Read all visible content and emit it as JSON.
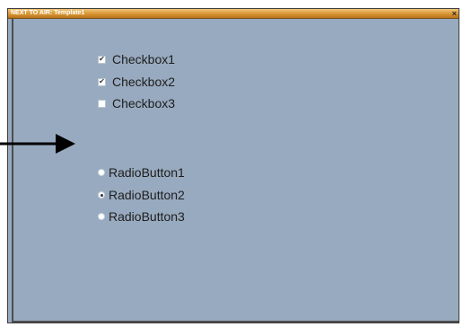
{
  "window": {
    "title": "NEXT TO AIR: Template1",
    "close_glyph": "×"
  },
  "checkboxes": [
    {
      "label": "Checkbox1",
      "checked": true
    },
    {
      "label": "Checkbox2",
      "checked": true
    },
    {
      "label": "Checkbox3",
      "checked": false
    }
  ],
  "radios": [
    {
      "label": "RadioButton1",
      "selected": false
    },
    {
      "label": "RadioButton2",
      "selected": true
    },
    {
      "label": "RadioButton3",
      "selected": false
    }
  ],
  "check_glyph": "✔",
  "colors": {
    "window_background": "#98aabf",
    "titlebar": "#d89432",
    "annotation_arrow": "#000000"
  },
  "icons": {
    "close": "close-icon",
    "arrow": "arrow-right-icon"
  }
}
